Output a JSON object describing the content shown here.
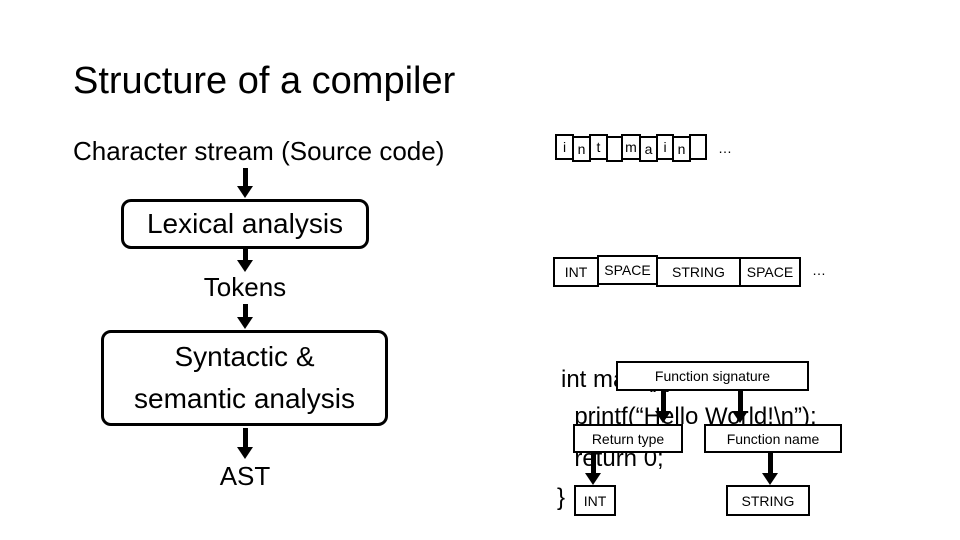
{
  "slide": {
    "title": "Structure of a compiler",
    "source_label": "Character stream (Source code)"
  },
  "pipeline": {
    "lexical": "Lexical analysis",
    "tokens": "Tokens",
    "syntactic_line1": "Syntactic &",
    "syntactic_line2": "semantic analysis",
    "ast": "AST"
  },
  "char_stream": {
    "chars": [
      "i",
      "n",
      "t",
      " ",
      "m",
      "a",
      "i",
      "n",
      " "
    ],
    "ellipsis": "…"
  },
  "token_stream": {
    "tokens": [
      "INT",
      "SPACE",
      "STRING",
      "SPACE"
    ],
    "ellipsis": "…"
  },
  "code": {
    "line1": "int main(){",
    "line2": "  printf(“Hello World!\\n”);",
    "line3": "  return 0;",
    "line4": "}"
  },
  "annotations": {
    "function_signature": "Function signature",
    "return_type": "Return type",
    "function_name": "Function name",
    "int_token": "INT",
    "string_token": "STRING"
  }
}
